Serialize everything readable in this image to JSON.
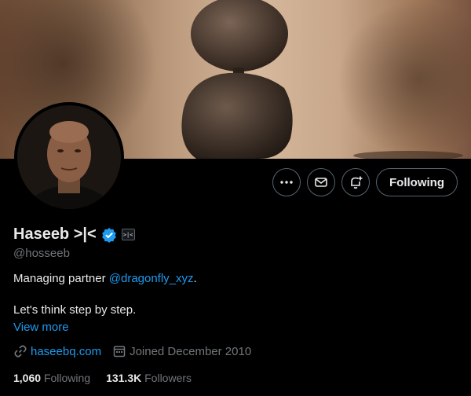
{
  "profile": {
    "name": "Haseeb >|<",
    "affiliate_badge": ">|<",
    "handle": "@hosseeb",
    "bio_line1_prefix": "Managing partner ",
    "bio_line1_mention": "@dragonfly_xyz",
    "bio_line1_suffix": ".",
    "bio_line2": "Let's think step by step.",
    "view_more": "View more",
    "website": "haseebq.com",
    "joined": "Joined December 2010"
  },
  "actions": {
    "more_icon": "more-icon",
    "message_icon": "envelope-icon",
    "notify_icon": "bell-plus-icon",
    "follow_label": "Following"
  },
  "stats": {
    "following_count": "1,060",
    "following_label": "Following",
    "followers_count": "131.3K",
    "followers_label": "Followers"
  },
  "colors": {
    "background": "#000000",
    "link": "#1d9bf0",
    "muted": "#71767b",
    "text": "#e7e9ea"
  }
}
